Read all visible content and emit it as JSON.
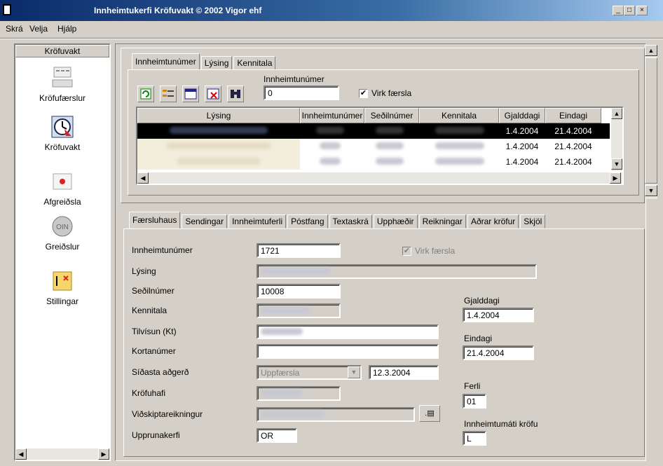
{
  "window": {
    "title": "Innheimtukerfi  Kröfuvakt © 2002 Vigor ehf",
    "btn_min": "_",
    "btn_max": "□",
    "btn_close": "×"
  },
  "menu": {
    "items": [
      "Skrá",
      "Velja",
      "Hjálp"
    ]
  },
  "sidebar": {
    "header": "Kröfuvakt",
    "items": [
      {
        "label": "Kröfufærslur",
        "icon": "document-list-icon"
      },
      {
        "label": "Kröfuvakt",
        "icon": "alarm-clock-icon"
      },
      {
        "label": "Afgreiðsla",
        "icon": "envelope-icon"
      },
      {
        "label": "Greiðslur",
        "icon": "coins-icon"
      },
      {
        "label": "Stillingar",
        "icon": "map-settings-icon"
      }
    ]
  },
  "upper": {
    "tabs": [
      "Innheimtunúmer",
      "Lýsing",
      "Kennitala"
    ],
    "search_label": "Innheimtunúmer",
    "search_value": "0",
    "active_check_label": "Virk færsla",
    "active_checked": true,
    "toolbar_icons": [
      "refresh-icon",
      "list-icon",
      "window-icon",
      "delete-icon",
      "binoculars-icon"
    ],
    "grid": {
      "columns": [
        "Lýsing",
        "Innheimtunúmer",
        "Seðilnúmer",
        "Kennitala",
        "Gjalddagi",
        "Eindagi"
      ],
      "rows": [
        {
          "gjalddagi": "1.4.2004",
          "eindagi": "21.4.2004",
          "selected": true
        },
        {
          "gjalddagi": "1.4.2004",
          "eindagi": "21.4.2004",
          "selected": false
        },
        {
          "gjalddagi": "1.4.2004",
          "eindagi": "21.4.2004",
          "selected": false
        }
      ]
    }
  },
  "lower": {
    "tabs": [
      "Færsluhaus",
      "Sendingar",
      "Innheimtuferli",
      "Póstfang",
      "Textaskrá",
      "Upphæðir",
      "Reikningar",
      "Aðrar kröfur",
      "Skjöl"
    ],
    "fields": {
      "innheimtunumer": {
        "label": "Innheimtunúmer",
        "value": "1721"
      },
      "virk_faersla": {
        "label": "Virk færsla",
        "checked": true
      },
      "lysing": {
        "label": "Lýsing",
        "value": ""
      },
      "sedilnumer": {
        "label": "Seðilnúmer",
        "value": "10008"
      },
      "kennitala": {
        "label": "Kennitala",
        "value": ""
      },
      "tilvisun": {
        "label": "Tilvísun (Kt)",
        "value": ""
      },
      "kortanumer": {
        "label": "Kortanúmer",
        "value": ""
      },
      "sidasta_adgerd": {
        "label": "Síðasta aðgerð",
        "value": "Uppfærsla",
        "date": "12.3.2004"
      },
      "krofuhafi": {
        "label": "Kröfuhafi",
        "value": ""
      },
      "vidskiptareikningur": {
        "label": "Viðskiptareikningur",
        "value": ""
      },
      "upprunakerfi": {
        "label": "Upprunakerfi",
        "value": "OR"
      },
      "gjalddagi": {
        "label": "Gjalddagi",
        "value": "1.4.2004"
      },
      "eindagi": {
        "label": "Eindagi",
        "value": "21.4.2004"
      },
      "ferli": {
        "label": "Ferli",
        "value": "01"
      },
      "innheimtumati": {
        "label": "Innheimtumáti kröfu",
        "value": "L"
      }
    }
  },
  "colors": {
    "title_start": "#0a2a6a",
    "title_end": "#a6caf0",
    "selection": "#000000",
    "face": "#d4d0c8"
  }
}
